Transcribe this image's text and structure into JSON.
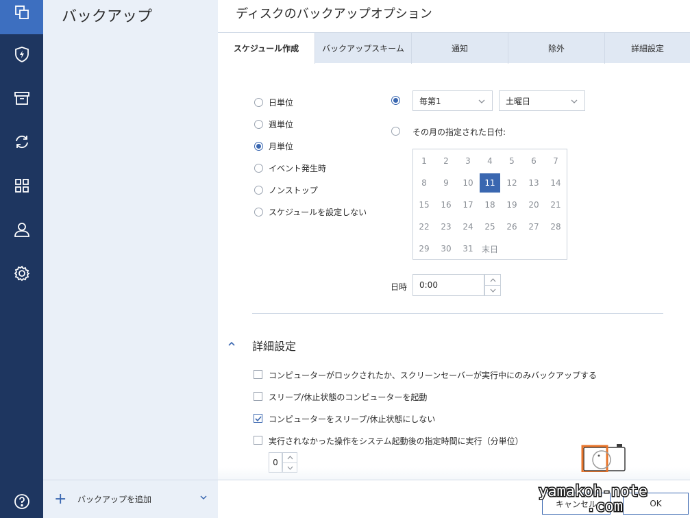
{
  "panel": {
    "title": "バックアップ",
    "add_label": "バックアップを追加"
  },
  "dialog": {
    "title": "ディスクのバックアップオプション"
  },
  "tabs": [
    {
      "label": "スケジュール作成"
    },
    {
      "label": "バックアップスキーム"
    },
    {
      "label": "通知"
    },
    {
      "label": "除外"
    },
    {
      "label": "詳細設定"
    }
  ],
  "frequency": {
    "options": [
      {
        "label": "日単位",
        "selected": false
      },
      {
        "label": "週単位",
        "selected": false
      },
      {
        "label": "月単位",
        "selected": true
      },
      {
        "label": "イベント発生時",
        "selected": false
      },
      {
        "label": "ノンストップ",
        "selected": false
      },
      {
        "label": "スケジュールを設定しない",
        "selected": false
      }
    ]
  },
  "monthly": {
    "week_select": "毎第1",
    "day_select": "土曜日",
    "specific_date_label": "その月の指定された日付:",
    "calendar": [
      [
        "1",
        "2",
        "3",
        "4",
        "5",
        "6",
        "7"
      ],
      [
        "8",
        "9",
        "10",
        "11",
        "12",
        "13",
        "14"
      ],
      [
        "15",
        "16",
        "17",
        "18",
        "19",
        "20",
        "21"
      ],
      [
        "22",
        "23",
        "24",
        "25",
        "26",
        "27",
        "28"
      ],
      [
        "29",
        "30",
        "31",
        "末日"
      ]
    ],
    "selected_day": "11",
    "time_label": "日時",
    "time_value": "0:00"
  },
  "advanced": {
    "title": "詳細設定",
    "options": [
      {
        "label": "コンピューターがロックされたか、スクリーンセーバーが実行中にのみバックアップする",
        "checked": false
      },
      {
        "label": "スリープ/休止状態のコンピューターを起動",
        "checked": false
      },
      {
        "label": "コンピューターをスリープ/休止状態にしない",
        "checked": true
      },
      {
        "label": "実行されなかった操作をシステム起動後の指定時間に実行（分単位）",
        "checked": false
      }
    ],
    "delay_value": "0"
  },
  "footer": {
    "cancel_label": "キャンセル",
    "ok_label": "OK"
  },
  "watermark": {
    "line1": "yamakoh-note",
    "line2": ".com"
  },
  "colors": {
    "rail": "#1e3660",
    "accent": "#3a67b0",
    "panel": "#eaf0f8",
    "watermark": "#e8742a"
  }
}
